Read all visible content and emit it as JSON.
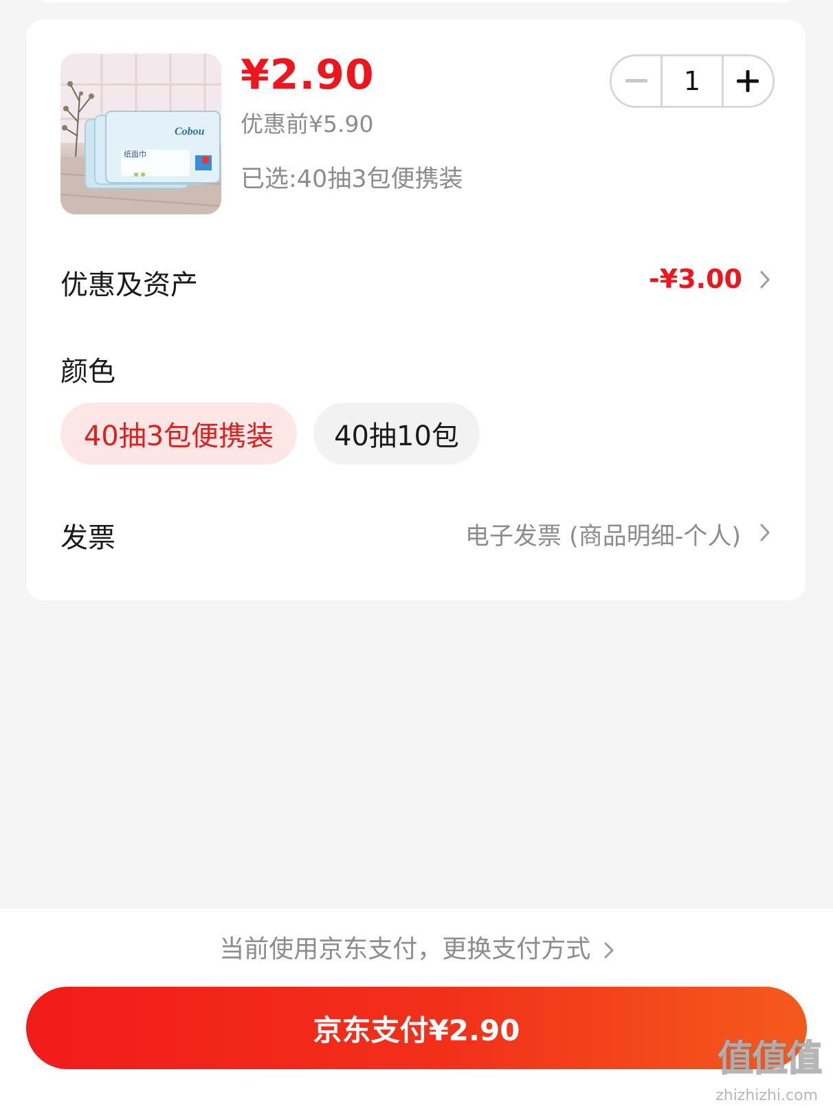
{
  "product": {
    "price": "¥2.90",
    "original_price": "优惠前¥5.90",
    "selected_variant": "已选:40抽3包便携装",
    "quantity": "1",
    "package_brand": "Cobou",
    "package_name": "纸面巾"
  },
  "discount": {
    "label": "优惠及资产",
    "value": "-¥3.00"
  },
  "color": {
    "label": "颜色",
    "options": [
      "40抽3包便携装",
      "40抽10包"
    ],
    "selected_index": 0
  },
  "invoice": {
    "label": "发票",
    "value": "电子发票 (商品明细-个人)"
  },
  "payment": {
    "method_text": "当前使用京东支付，更换支付方式",
    "pay_button": "京东支付¥2.90"
  },
  "watermark": {
    "text": "值值值",
    "url": "zhizhizhi.com"
  },
  "colors": {
    "accent": "#f0151d",
    "chip_active_bg": "#fde7e6",
    "button_gradient_start": "#f21b1b",
    "button_gradient_end": "#f45a1c"
  }
}
